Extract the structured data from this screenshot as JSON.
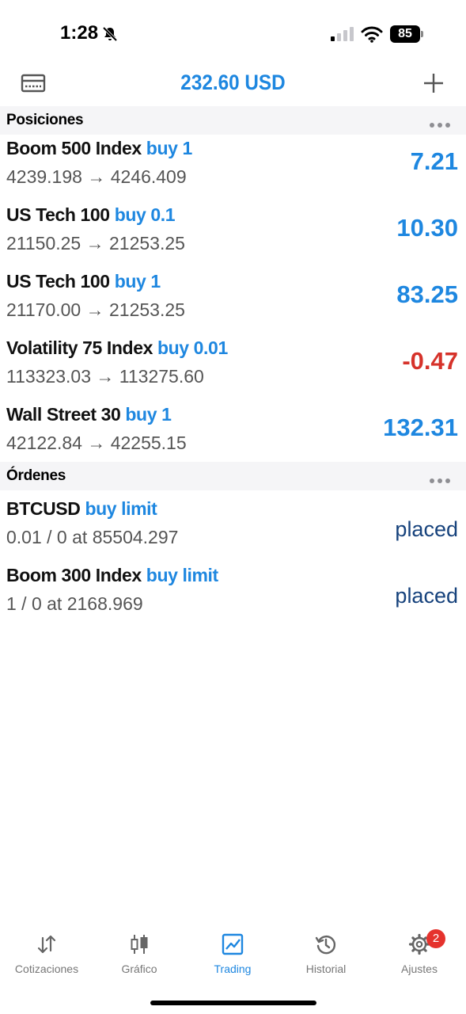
{
  "status_bar": {
    "time": "1:28",
    "battery": "85"
  },
  "header": {
    "balance": "232.60 USD"
  },
  "positions": {
    "title": "Posiciones",
    "items": [
      {
        "symbol": "Boom 500 Index",
        "action": "buy 1",
        "prices": "4239.198 → 4246.409",
        "profit": "7.21"
      },
      {
        "symbol": "US Tech 100",
        "action": "buy 0.1",
        "prices": "21150.25 → 21253.25",
        "profit": "10.30"
      },
      {
        "symbol": "US Tech 100",
        "action": "buy 1",
        "prices": "21170.00 → 21253.25",
        "profit": "83.25"
      },
      {
        "symbol": "Volatility 75 Index",
        "action": "buy 0.01",
        "prices": "113323.03 → 113275.60",
        "profit": "-0.47"
      },
      {
        "symbol": "Wall Street 30",
        "action": "buy 1",
        "prices": "42122.84 → 42255.15",
        "profit": "132.31"
      }
    ]
  },
  "orders": {
    "title": "Órdenes",
    "items": [
      {
        "symbol": "BTCUSD",
        "action": "buy limit",
        "details": "0.01 / 0 at 85504.297",
        "status": "placed"
      },
      {
        "symbol": "Boom 300 Index",
        "action": "buy limit",
        "details": "1 / 0 at 2168.969",
        "status": "placed"
      }
    ]
  },
  "tabs": [
    {
      "label": "Cotizaciones",
      "icon": "quotes-arrows-icon"
    },
    {
      "label": "Gráfico",
      "icon": "candlestick-chart-icon"
    },
    {
      "label": "Trading",
      "icon": "trading-chart-icon"
    },
    {
      "label": "Historial",
      "icon": "history-clock-icon"
    },
    {
      "label": "Ajustes",
      "icon": "settings-gear-icon",
      "badge": "2"
    }
  ],
  "colors": {
    "accent": "#1e87e0",
    "negative": "#d6322a",
    "status": "#16427c",
    "badge": "#e5322d"
  }
}
